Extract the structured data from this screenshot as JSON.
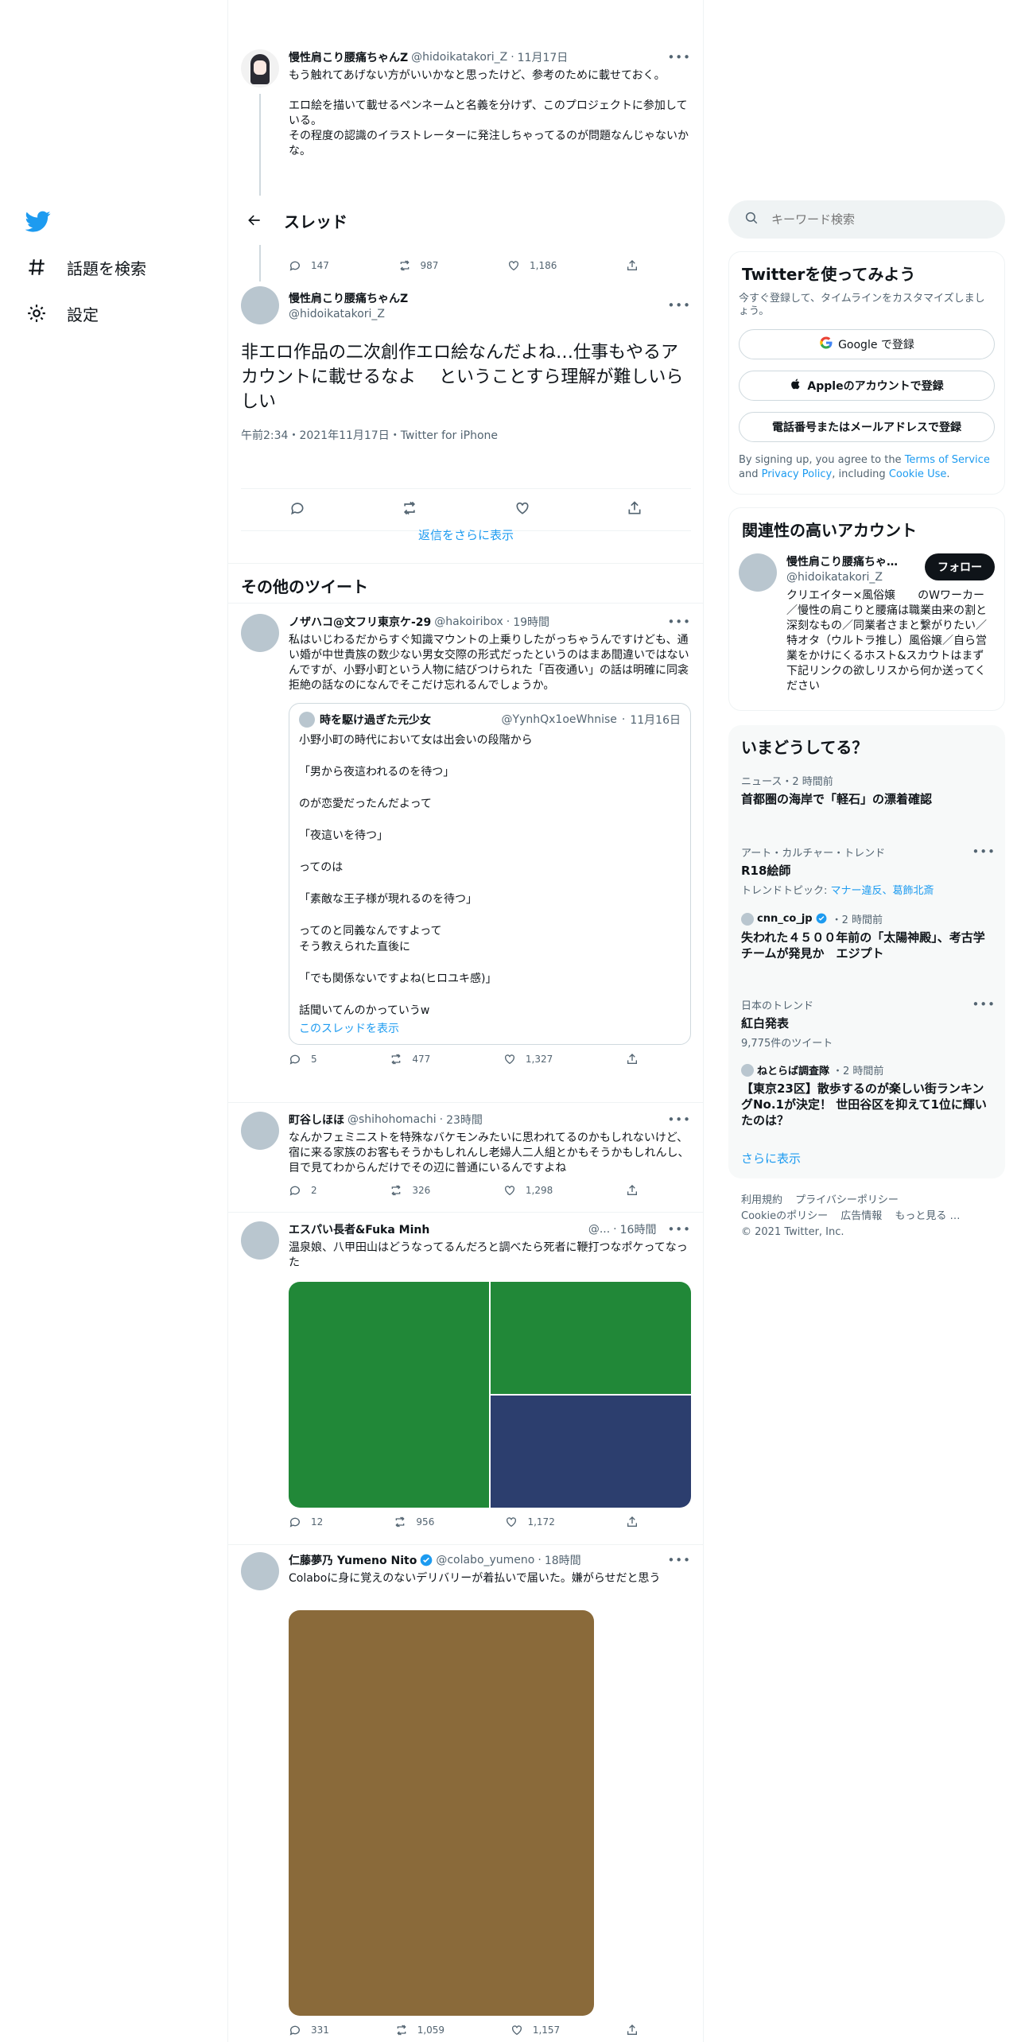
{
  "nav": {
    "items": [
      {
        "label": "話題を検索",
        "icon": "hashtag-icon"
      },
      {
        "label": "設定",
        "icon": "gear-icon"
      }
    ]
  },
  "top_tweet": {
    "name": "慢性肩こり腰痛ちゃんZ",
    "handle": "@hidoikatakori_Z",
    "time": "11月17日",
    "text": "もう触れてあげない方がいいかなと思ったけど、参考のために載せておく。\n\nエロ絵を描いて載せるペンネームと名義を分けず、このプロジェクトに参加している。\nその程度の認識のイラストレーターに発注しちゃってるのが問題なんじゃないかな。",
    "replies": "147",
    "retweets": "987",
    "likes": "1,186"
  },
  "header": {
    "title": "スレッド"
  },
  "main_tweet": {
    "name": "慢性肩こり腰痛ちゃんZ",
    "handle": "@hidoikatakori_Z",
    "text": "非エロ作品の二次創作エロ絵なんだよね…仕事もやるアカウントに載せるなよ　 ということすら理解が難しいらしい",
    "meta": "午前2:34・2021年11月17日・Twitter for iPhone",
    "show_more_replies": "返信をさらに表示"
  },
  "other_tweets_title": "その他のツイート",
  "tweets": [
    {
      "name": "ノザハコ@文フリ東京ケ-29",
      "handle": "@hakoiribox",
      "time": "19時間",
      "text": "私はいじわるだからすぐ知識マウントの上乗りしたがっちゃうんですけども、通い婚が中世貴族の数少ない男女交際の形式だったというのはまあ間違いではないんですが、小野小町という人物に結びつけられた「百夜通い」の話は明確に同衾拒絶の話なのになんでそこだけ忘れるんでしょうか。",
      "quote": {
        "name": "時を駆け過ぎた元少女",
        "handle": "@YynhQx1oeWhnise",
        "time": "11月16日",
        "text": "小野小町の時代において女は出会いの段階から\n\n「男から夜這われるのを待つ」\n\nのが恋愛だったんだよって\n\n「夜這いを待つ」\n\nってのは\n\n「素敵な王子様が現れるのを待つ」\n\nってのと同義なんですよって\nそう教えられた直後に\n\n「でも関係ないですよね(ヒロユキ感)」\n\n話聞いてんのかっていうw",
        "link": "このスレッドを表示"
      },
      "replies": "5",
      "retweets": "477",
      "likes": "1,327"
    },
    {
      "name": "町谷しほほ",
      "handle": "@shihohomachi",
      "time": "23時間",
      "text": "なんかフェミニストを特殊なバケモンみたいに思われてるのかもしれないけど、宿に来る家族のお客もそうかもしれんし老婦人二人組とかもそうかもしれんし、目で見てわからんだけでその辺に普通にいるんですよね",
      "replies": "2",
      "retweets": "326",
      "likes": "1,298"
    },
    {
      "name": "エスパい長者&Fuka Minh",
      "handle": "@...",
      "time": "16時間",
      "text": "温泉娘、八甲田山はどうなってるんだろと調べたら死者に鞭打つなポケってなった",
      "replies": "12",
      "retweets": "956",
      "likes": "1,172",
      "media_colors": [
        "#218838",
        "#218838",
        "#2c3e6e"
      ]
    },
    {
      "name": "仁藤夢乃 Yumeno Nito",
      "handle": "@colabo_yumeno",
      "time": "18時間",
      "text": "Colaboに身に覚えのないデリバリーが着払いで届いた。嫌がらせだと思う",
      "replies": "331",
      "retweets": "1,059",
      "likes": "1,157",
      "media_color": "#8a6a3a"
    }
  ],
  "search": {
    "placeholder": "キーワード検索"
  },
  "signup": {
    "title": "Twitterを使ってみよう",
    "subtitle": "今すぐ登録して、タイムラインをカスタマイズしましょう。",
    "google": "Google で登録",
    "apple": "Appleのアカウントで登録",
    "phone": "電話番号またはメールアドレスで登録",
    "terms_prefix": "By signing up, you agree to the ",
    "terms_link": "Terms of Service",
    "terms_and": " and ",
    "privacy_link": "Privacy Policy",
    "terms_incl": ", including ",
    "cookie_link": "Cookie Use",
    "terms_end": "."
  },
  "related": {
    "title": "関連性の高いアカウント",
    "name": "慢性肩こり腰痛ちゃ…",
    "handle": "@hidoikatakori_Z",
    "follow": "フォロー",
    "bio": "クリエイター×風俗嬢　　のWワーカー／慢性の肩こりと腰痛は職業由来の割と深刻なもの／同業者さまと繋がりたい／特オタ（ウルトラ推し）風俗嬢／自ら営業をかけにくるホスト&スカウトはまず下記リンクの欲しリスから何か送ってください"
  },
  "trends": {
    "title": "いまどうしてる？",
    "items": [
      {
        "meta": "ニュース・2 時間前",
        "title": "首都圏の海岸で「軽石」の漂着確認"
      },
      {
        "meta": "アート・カルチャー・トレンド",
        "title": "R18絵師",
        "sub_prefix": "トレンドトピック: ",
        "sub_link": "マナー違反、葛飾北斎"
      },
      {
        "meta_name": "cnn_co_jp",
        "meta": "・2 時間前",
        "title": "失われた４５００年前の「太陽神殿」、考古学チームが発見か　エジプト"
      },
      {
        "meta": "日本のトレンド",
        "title": "紅白発表",
        "sub": "9,775件のツイート"
      },
      {
        "meta_name": "ねとらば調査隊",
        "meta": "・2 時間前",
        "title": "【東京23区】散歩するのが楽しい街ランキングNo.1が決定！ 世田谷区を抑えて1位に輝いたのは？"
      }
    ],
    "show_more": "さらに表示"
  },
  "footer": {
    "links": [
      "利用規約",
      "プライバシーポリシー",
      "Cookieのポリシー",
      "広告情報",
      "もっと見る …"
    ],
    "copyright": "© 2021 Twitter, Inc."
  },
  "colors": {
    "accent": "#1d9bf0",
    "text": "#0f1419",
    "muted": "#536471"
  }
}
